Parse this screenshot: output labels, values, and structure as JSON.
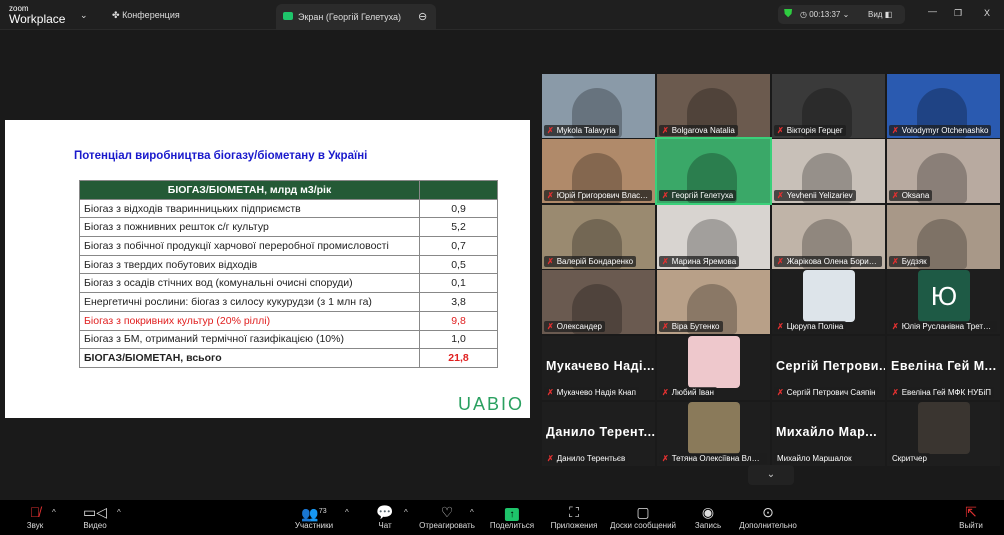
{
  "topbar": {
    "logo_small": "zoom",
    "logo_big": "Workplace",
    "meeting": "Конференция",
    "share_tab": "Экран (Георгій Гелетуха)",
    "timer": "00:13:37",
    "view": "Вид"
  },
  "slide": {
    "title": "Потенціал виробництва біогазу/біометану в Україні",
    "header": "БІОГАЗ/БІОМЕТАН, млрд м3/рік",
    "rows": [
      {
        "label": "Біогаз з відходів тваринницьких підприємств",
        "value": "0,9"
      },
      {
        "label": "Біогаз з пожнивних решток с/г культур",
        "value": "5,2"
      },
      {
        "label": "Біогаз з побічної продукції харчової переробної промисловості",
        "value": "0,7"
      },
      {
        "label": "Біогаз з твердих побутових відходів",
        "value": "0,5"
      },
      {
        "label": "Біогаз з осадів стічних вод (комунальні очисні споруди)",
        "value": "0,1"
      },
      {
        "label": "Енергетичні рослини: біогаз з силосу кукурудзи (з 1 млн га)",
        "value": "3,8"
      },
      {
        "label": "Біогаз з покривних культур (20% ріллі)",
        "value": "9,8"
      },
      {
        "label": "Біогаз з БМ, отриманий термічної газифікацією (10%)",
        "value": "1,0"
      },
      {
        "label": "БІОГАЗ/БІОМЕТАН, всього",
        "value": "21,8"
      }
    ],
    "brand": "UABIO"
  },
  "participants": [
    {
      "name": "Mykola Talavyria",
      "bg": "#8a9aa8"
    },
    {
      "name": "Bolgarova Natalia",
      "bg": "#6b5a4e"
    },
    {
      "name": "Вікторія Герцег",
      "bg": "#3a3a3a"
    },
    {
      "name": "Volodymyr Otchenashko",
      "bg": "#2a5ab0"
    },
    {
      "name": "Юрій Григорович Власенко",
      "bg": "#b08a6a"
    },
    {
      "name": "Георгій Гелетуха",
      "bg": "#3aa868",
      "active": true
    },
    {
      "name": "Yevhenii Yelizariev",
      "bg": "#c8c0b8"
    },
    {
      "name": "Oksana",
      "bg": "#b8aaa0"
    },
    {
      "name": "Валерій Бондаренко",
      "bg": "#9a8a70"
    },
    {
      "name": "Марина Яремова",
      "bg": "#d8d4d0"
    },
    {
      "name": "Жарікова Олена Борисівна",
      "bg": "#c0b4a8"
    },
    {
      "name": "Будзяк",
      "bg": "#a89888"
    },
    {
      "name": "Олександер",
      "bg": "#6a5a50"
    },
    {
      "name": "Віра Бутенко",
      "bg": "#b8a088"
    },
    {
      "name": "Цюрупа Поліна",
      "bg": "#1e1e1e",
      "avatar": "#dde4ea"
    },
    {
      "name": "Юлія Русланівна Третякова",
      "bg": "#1e1e1e",
      "avatar": "#1e5a45",
      "initial": "Ю"
    },
    {
      "name": "Мукачево Надія Кнап",
      "big": "Мукачево Наді..."
    },
    {
      "name": "Любий Іван",
      "bg": "#1e1e1e",
      "avatar": "#eec8cc"
    },
    {
      "name": "Сергій Петрович Саяпін",
      "big": "Сергій Петрови..."
    },
    {
      "name": "Евеліна Гей МФК НУБіП",
      "big": "Евеліна Гей М..."
    },
    {
      "name": "Данило Терентьєв",
      "big": "Данило Терент..."
    },
    {
      "name": "Тетяна Олексіївна Власенко",
      "bg": "#1e1e1e",
      "avatar": "#8a7a5a"
    },
    {
      "name": "Михайло Маршалок",
      "big": "Михайло Мар...",
      "nomic": true
    },
    {
      "name": "Скритчер",
      "bg": "#1e1e1e",
      "avatar": "#3a3530",
      "nomic": true
    }
  ],
  "toolbar": {
    "audio": "Звук",
    "video": "Видео",
    "participants": "Участники",
    "count": "73",
    "chat": "Чат",
    "react": "Отреагировать",
    "share": "Поделиться",
    "apps": "Приложения",
    "boards": "Доски сообщений",
    "record": "Запись",
    "more": "Дополнительно",
    "leave": "Выйти"
  },
  "colors": {
    "share": "#1ec46a",
    "active": "#3ad07a"
  }
}
